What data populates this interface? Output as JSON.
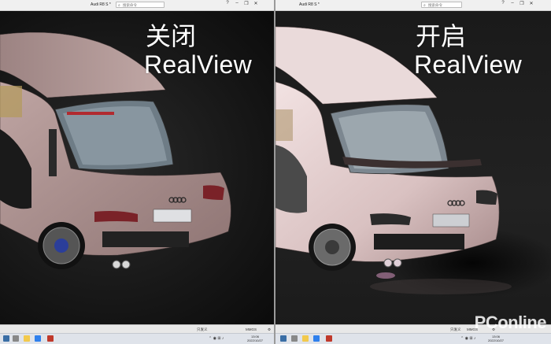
{
  "left": {
    "window_title": "Audi R8 S *",
    "search_placeholder": "搜索命令",
    "overlay_cn": "关闭",
    "overlay_en": "RealView",
    "status_center": "只发义",
    "status_unit": "MMGS",
    "time": "13:06",
    "date": "2022/10/27"
  },
  "right": {
    "window_title": "Audi R8 S *",
    "search_placeholder": "搜索命令",
    "overlay_cn": "开启",
    "overlay_en": "RealView",
    "status_center": "只发义",
    "status_unit": "MMGS",
    "time": "13:06",
    "date": "2022/10/27"
  },
  "watermark": "PConline",
  "colors": {
    "car_body": "#b59a98",
    "car_body_lit": "#e3cfcf",
    "viewport_dark": "#141414",
    "taskbar": "#dfe3ea"
  }
}
